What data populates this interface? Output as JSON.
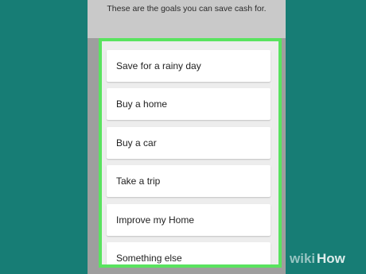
{
  "header": {
    "subtitle": "These are the goals you can save cash for."
  },
  "goals": [
    {
      "label": "Save for a rainy day"
    },
    {
      "label": "Buy a home"
    },
    {
      "label": "Buy a car"
    },
    {
      "label": "Take a trip"
    },
    {
      "label": "Improve my Home"
    },
    {
      "label": "Something else"
    }
  ],
  "colors": {
    "background": "#177d75",
    "highlight_border": "#59e35f",
    "card": "#ffffff"
  },
  "watermark": {
    "text": "wikiHow"
  }
}
